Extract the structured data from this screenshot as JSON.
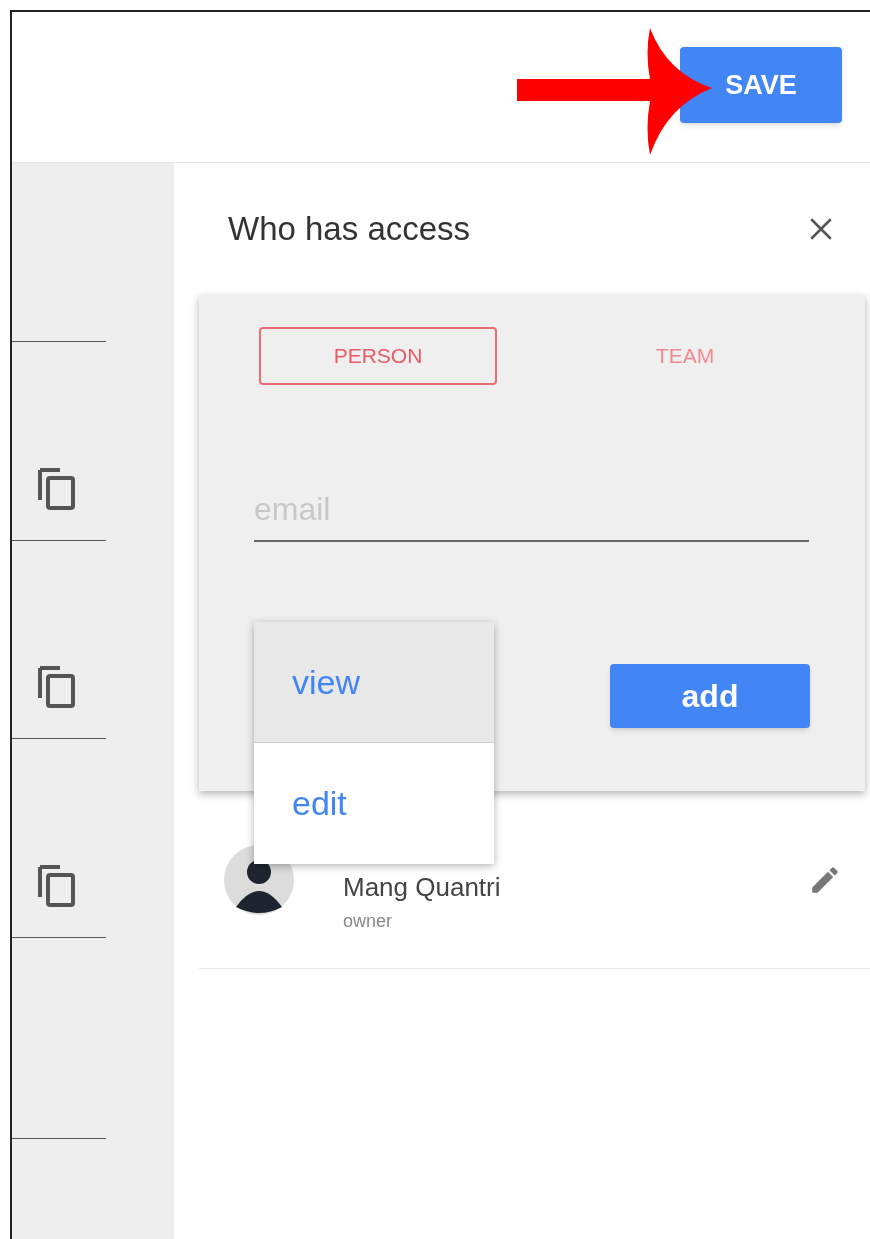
{
  "toolbar": {
    "save_button": "SAVE"
  },
  "sidebar": {
    "rows": [
      {
        "kind": "blank"
      },
      {
        "kind": "copy"
      },
      {
        "kind": "copy"
      },
      {
        "kind": "copy"
      },
      {
        "kind": "blank"
      }
    ]
  },
  "access_panel": {
    "title": "Who has access",
    "tabs": [
      {
        "label": "PERSON",
        "selected": true
      },
      {
        "label": "TEAM",
        "selected": false
      }
    ],
    "email_field": {
      "placeholder": "email"
    },
    "permission_menu": {
      "items": [
        {
          "label": "view",
          "selected": true
        },
        {
          "label": "edit",
          "selected": false
        }
      ]
    },
    "add_button": "add",
    "members": [
      {
        "name": "Mang Quantri",
        "role": "owner"
      }
    ]
  }
}
